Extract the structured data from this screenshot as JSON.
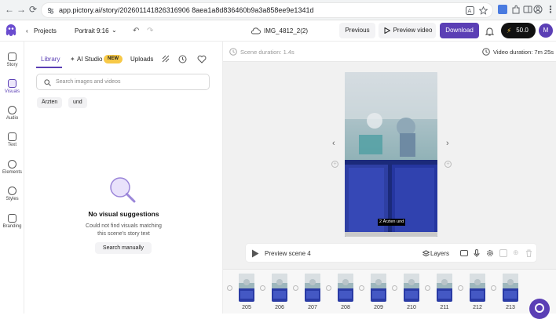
{
  "browser": {
    "url": "app.pictory.ai/story/202601141826316906 8aea1a8d836460b9a3a858ee9e1341d"
  },
  "header": {
    "projects_label": "Projects",
    "format_label": "Portrait 9:16",
    "project_name": "IMG_4812_2(2)",
    "previous_label": "Previous",
    "preview_video_label": "Preview video",
    "download_label": "Download",
    "credits": "50.0",
    "avatar_initial": "M"
  },
  "rail": {
    "items": [
      {
        "label": "Story",
        "icon": "story-icon"
      },
      {
        "label": "Visuals",
        "icon": "visuals-icon"
      },
      {
        "label": "Audio",
        "icon": "audio-icon"
      },
      {
        "label": "Text",
        "icon": "text-icon"
      },
      {
        "label": "Elements",
        "icon": "elements-icon"
      },
      {
        "label": "Styles",
        "icon": "styles-icon"
      },
      {
        "label": "Branding",
        "icon": "branding-icon"
      }
    ]
  },
  "visuals": {
    "tabs": {
      "library": "Library",
      "ai_studio": "AI Studio",
      "new_badge": "NEW",
      "uploads": "Uploads"
    },
    "search_placeholder": "Search images and videos",
    "chips": [
      "Ärzten",
      "und"
    ],
    "empty_title": "No visual suggestions",
    "empty_desc": "Could not find visuals matching this scene's story text",
    "search_manually": "Search manually"
  },
  "canvas": {
    "scene_duration": "Scene duration: 1.4s",
    "video_duration": "Video duration: 7m 25s",
    "caption": "2 Ärzten und",
    "preview_scene": "Preview scene 4",
    "layers": "Layers"
  },
  "timeline": {
    "scene_numbers": [
      "205",
      "206",
      "207",
      "208",
      "209",
      "210",
      "211",
      "212",
      "213"
    ]
  },
  "colors": {
    "accent": "#5b3fb5",
    "badge": "#f7c948",
    "download_btn": "#5b3fb5"
  }
}
